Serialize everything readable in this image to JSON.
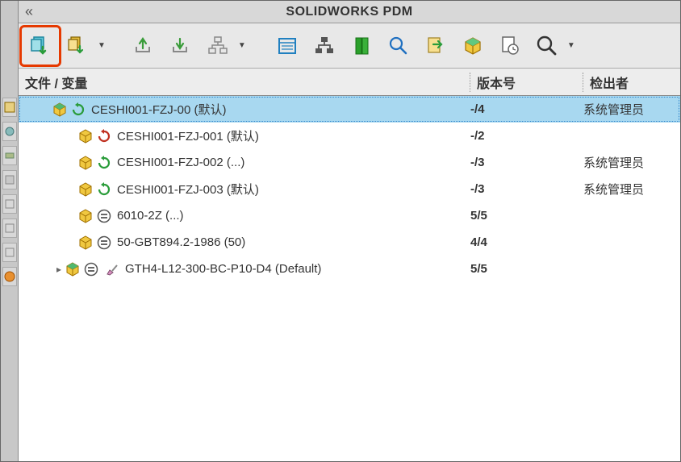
{
  "titlebar": {
    "title": "SOLIDWORKS PDM",
    "collapse": "«"
  },
  "columns": {
    "col1": "文件 / 变量",
    "col2": "版本号",
    "col3": "检出者"
  },
  "tree": [
    {
      "indent": 28,
      "expander": "",
      "kind": "assembly",
      "status": "refresh-green",
      "name": "CESHI001-FZJ-00  (默认)",
      "version": "-/4",
      "checkout": "系统管理员",
      "selected": true
    },
    {
      "indent": 60,
      "expander": "",
      "kind": "part",
      "status": "refresh-red",
      "name": "CESHI001-FZJ-001  (默认)",
      "version": "-/2",
      "checkout": ""
    },
    {
      "indent": 60,
      "expander": "",
      "kind": "part",
      "status": "refresh-green",
      "name": "CESHI001-FZJ-002  (...)",
      "version": "-/3",
      "checkout": "系统管理员"
    },
    {
      "indent": 60,
      "expander": "",
      "kind": "part",
      "status": "refresh-green",
      "name": "CESHI001-FZJ-003  (默认)",
      "version": "-/3",
      "checkout": "系统管理员"
    },
    {
      "indent": 60,
      "expander": "",
      "kind": "part",
      "status": "equal",
      "name": "6010-2Z  (...)",
      "version": "5/5",
      "checkout": ""
    },
    {
      "indent": 60,
      "expander": "",
      "kind": "part",
      "status": "equal",
      "name": "50-GBT894.2-1986  (50)",
      "version": "4/4",
      "checkout": ""
    },
    {
      "indent": 44,
      "expander": "▸",
      "kind": "assembly",
      "status": "equal",
      "extra": "brush",
      "name": "GTH4-L12-300-BC-P10-D4  (Default)",
      "version": "5/5",
      "checkout": ""
    }
  ]
}
